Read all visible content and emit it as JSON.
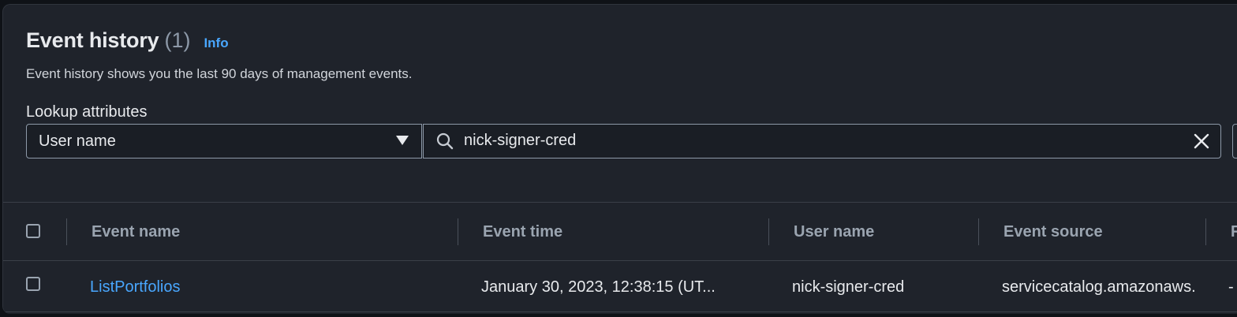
{
  "header": {
    "title": "Event history",
    "count": "(1)",
    "info_link": "Info",
    "description": "Event history shows you the last 90 days of management events."
  },
  "lookup": {
    "label": "Lookup attributes",
    "attribute_selected": "User name",
    "search_value": "nick-signer-cred"
  },
  "table": {
    "columns": [
      "Event name",
      "Event time",
      "User name",
      "Event source",
      "R"
    ],
    "rows": [
      {
        "event_name": "ListPortfolios",
        "event_time": "January 30, 2023, 12:38:15 (UT...",
        "user_name": "nick-signer-cred",
        "event_source": "servicecatalog.amazonaws.",
        "resource": "-"
      }
    ]
  },
  "colors": {
    "panel_background": "#1f232b",
    "link": "#49a7ff",
    "text_primary": "#e8eaed",
    "text_secondary": "#9aa4b0"
  }
}
